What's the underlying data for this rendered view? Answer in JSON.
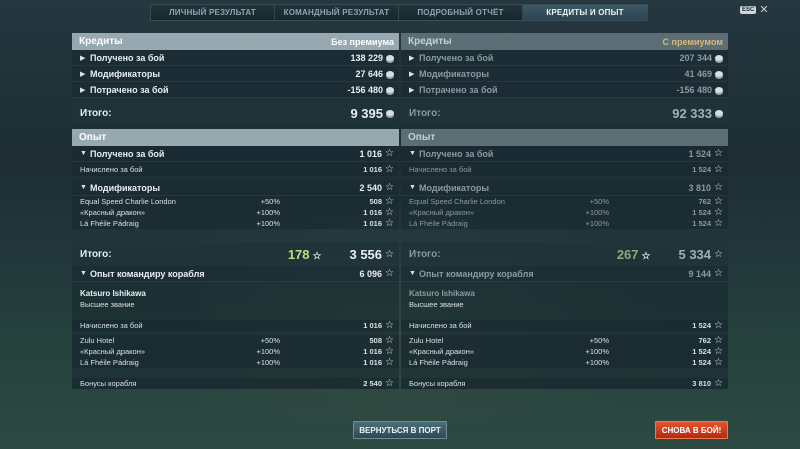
{
  "tabs": [
    {
      "label": "ЛИЧНЫЙ РЕЗУЛЬТАТ"
    },
    {
      "label": "КОМАНДНЫЙ РЕЗУЛЬТАТ"
    },
    {
      "label": "ПОДРОБНЫЙ ОТЧЁТ"
    },
    {
      "label": "КРЕДИТЫ И ОПЫТ"
    }
  ],
  "esc": {
    "key": "ESC",
    "close": "✕"
  },
  "left": {
    "credits_title": "Кредиты",
    "credits_sub": "Без премиума",
    "credits_rows": [
      {
        "label": "Получено за бой",
        "value": "138 229"
      },
      {
        "label": "Модификаторы",
        "value": "27 646"
      },
      {
        "label": "Потрачено за бой",
        "value": "-156 480"
      }
    ],
    "credits_total_label": "Итого:",
    "credits_total": "9 395",
    "xp_title": "Опыт",
    "xp_earned_label": "Получено за бой",
    "xp_earned_value": "1 016",
    "xp_accrued_label": "Начислено за бой",
    "xp_accrued_value": "1 016",
    "xp_mod_label": "Модификаторы",
    "xp_mod_value": "2 540",
    "xp_mods": [
      {
        "label": "Equal Speed Charlie London",
        "pct": "+50%",
        "value": "508"
      },
      {
        "label": "«Красный дракон»",
        "pct": "+100%",
        "value": "1 016"
      },
      {
        "label": "Lá Fhéile Pádraig",
        "pct": "+100%",
        "value": "1 016"
      }
    ],
    "xp_total_label": "Итого:",
    "xp_total_free": "178",
    "xp_total": "3 556",
    "cmd_label": "Опыт командиру корабля",
    "cmd_value": "6 096",
    "cmd_name": "Katsuro Ishikawa",
    "cmd_rank": "Высшее звание",
    "cmd_accrued_label": "Начислено за бой",
    "cmd_accrued_value": "1 016",
    "cmd_mods": [
      {
        "label": "Zulu Hotel",
        "pct": "+50%",
        "value": "508"
      },
      {
        "label": "«Красный дракон»",
        "pct": "+100%",
        "value": "1 016"
      },
      {
        "label": "Lá Fhéile Pádraig",
        "pct": "+100%",
        "value": "1 016"
      }
    ],
    "ship_bonus_label": "Бонусы корабля",
    "ship_bonus_value": "2 540"
  },
  "right": {
    "credits_title": "Кредиты",
    "credits_sub": "С премиумом",
    "credits_rows": [
      {
        "label": "Получено за бой",
        "value": "207 344"
      },
      {
        "label": "Модификаторы",
        "value": "41 469"
      },
      {
        "label": "Потрачено за бой",
        "value": "-156 480"
      }
    ],
    "credits_total_label": "Итого:",
    "credits_total": "92 333",
    "xp_title": "Опыт",
    "xp_earned_label": "Получено за бой",
    "xp_earned_value": "1 524",
    "xp_accrued_label": "Начислено за бой",
    "xp_accrued_value": "1 524",
    "xp_mod_label": "Модификаторы",
    "xp_mod_value": "3 810",
    "xp_mods": [
      {
        "label": "Equal Speed Charlie London",
        "pct": "+50%",
        "value": "762"
      },
      {
        "label": "«Красный дракон»",
        "pct": "+100%",
        "value": "1 524"
      },
      {
        "label": "Lá Fhéile Pádraig",
        "pct": "+100%",
        "value": "1 524"
      }
    ],
    "xp_total_label": "Итого:",
    "xp_total_free": "267",
    "xp_total": "5 334",
    "cmd_label": "Опыт командиру корабля",
    "cmd_value": "9 144",
    "cmd_name": "Katsuro Ishikawa",
    "cmd_rank": "Высшее звание",
    "cmd_accrued_label": "Начислено за бой",
    "cmd_accrued_value": "1 524",
    "cmd_mods": [
      {
        "label": "Zulu Hotel",
        "pct": "+50%",
        "value": "762"
      },
      {
        "label": "«Красный дракон»",
        "pct": "+100%",
        "value": "1 524"
      },
      {
        "label": "Lá Fhéile Pádraig",
        "pct": "+100%",
        "value": "1 524"
      }
    ],
    "ship_bonus_label": "Бонусы корабля",
    "ship_bonus_value": "3 810"
  },
  "buttons": {
    "port": "ВЕРНУТЬСЯ В ПОРТ",
    "battle": "СНОВА В БОЙ!"
  },
  "colors": {
    "accent_green": "#b9e07a",
    "battle_red": "#c8391a",
    "premium_gold": "#d8b978"
  },
  "icons": {
    "credit": "coin-icon",
    "xp": "star-icon",
    "expand": "triangle-right-icon",
    "collapse": "triangle-down-icon"
  }
}
